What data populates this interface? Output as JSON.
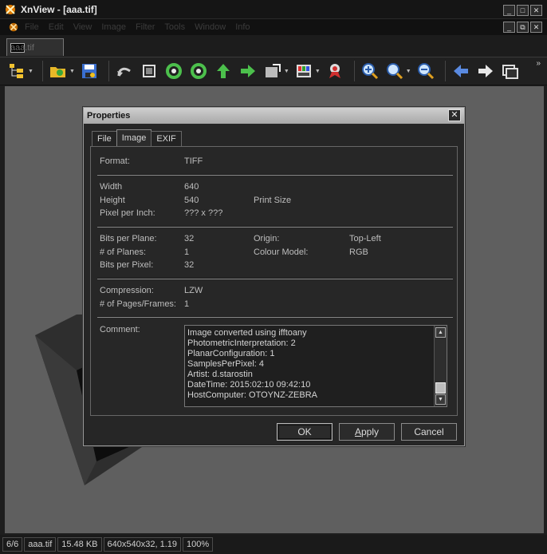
{
  "app": {
    "title": "XnView - [aaa.tif]",
    "window_buttons": [
      "_",
      "□",
      "✕"
    ],
    "mdi_buttons": [
      "_",
      "⧉",
      "✕"
    ]
  },
  "menu": {
    "items": [
      "File",
      "Edit",
      "View",
      "Image",
      "Filter",
      "Tools",
      "Window",
      "Info"
    ]
  },
  "document_tab": {
    "label": "aaa.tif"
  },
  "toolbar": {
    "overflow": "»"
  },
  "dialog": {
    "title": "Properties",
    "close": "✕",
    "tabs": [
      "File",
      "Image",
      "EXIF"
    ],
    "active_tab": "Image",
    "fields": {
      "format_label": "Format:",
      "format_value": "TIFF",
      "width_label": "Width",
      "width_value": "640",
      "height_label": "Height",
      "height_value": "540",
      "print_size_label": "Print Size",
      "ppi_label": "Pixel per Inch:",
      "ppi_value": "??? x ???",
      "bpp_plane_label": "Bits per Plane:",
      "bpp_plane_value": "32",
      "origin_label": "Origin:",
      "origin_value": "Top-Left",
      "planes_label": "# of Planes:",
      "planes_value": "1",
      "colour_model_label": "Colour Model:",
      "colour_model_value": "RGB",
      "bpp_pixel_label": "Bits per Pixel:",
      "bpp_pixel_value": "32",
      "compression_label": "Compression:",
      "compression_value": "LZW",
      "pages_label": "# of Pages/Frames:",
      "pages_value": "1",
      "comment_label": "Comment:"
    },
    "comment_lines": [
      "Image converted using ifftoany",
      "PhotometricInterpretation: 2",
      "PlanarConfiguration: 1",
      "SamplesPerPixel: 4",
      "Artist: d.starostin",
      "DateTime: 2015:02:10 09:42:10",
      "HostComputer: OTOYNZ-ZEBRA"
    ],
    "buttons": {
      "ok": "OK",
      "apply_underlined": "A",
      "apply_rest": "pply",
      "cancel": "Cancel"
    }
  },
  "statusbar": {
    "index": "6/6",
    "filename": "aaa.tif",
    "size": "15.48 KB",
    "dimensions": "640x540x32, 1.19",
    "zoom": "100%"
  },
  "colors": {
    "canvas": "#5f5f5f",
    "dialog_bg": "#262626",
    "title_gradient_top": "#cfcfcf"
  }
}
